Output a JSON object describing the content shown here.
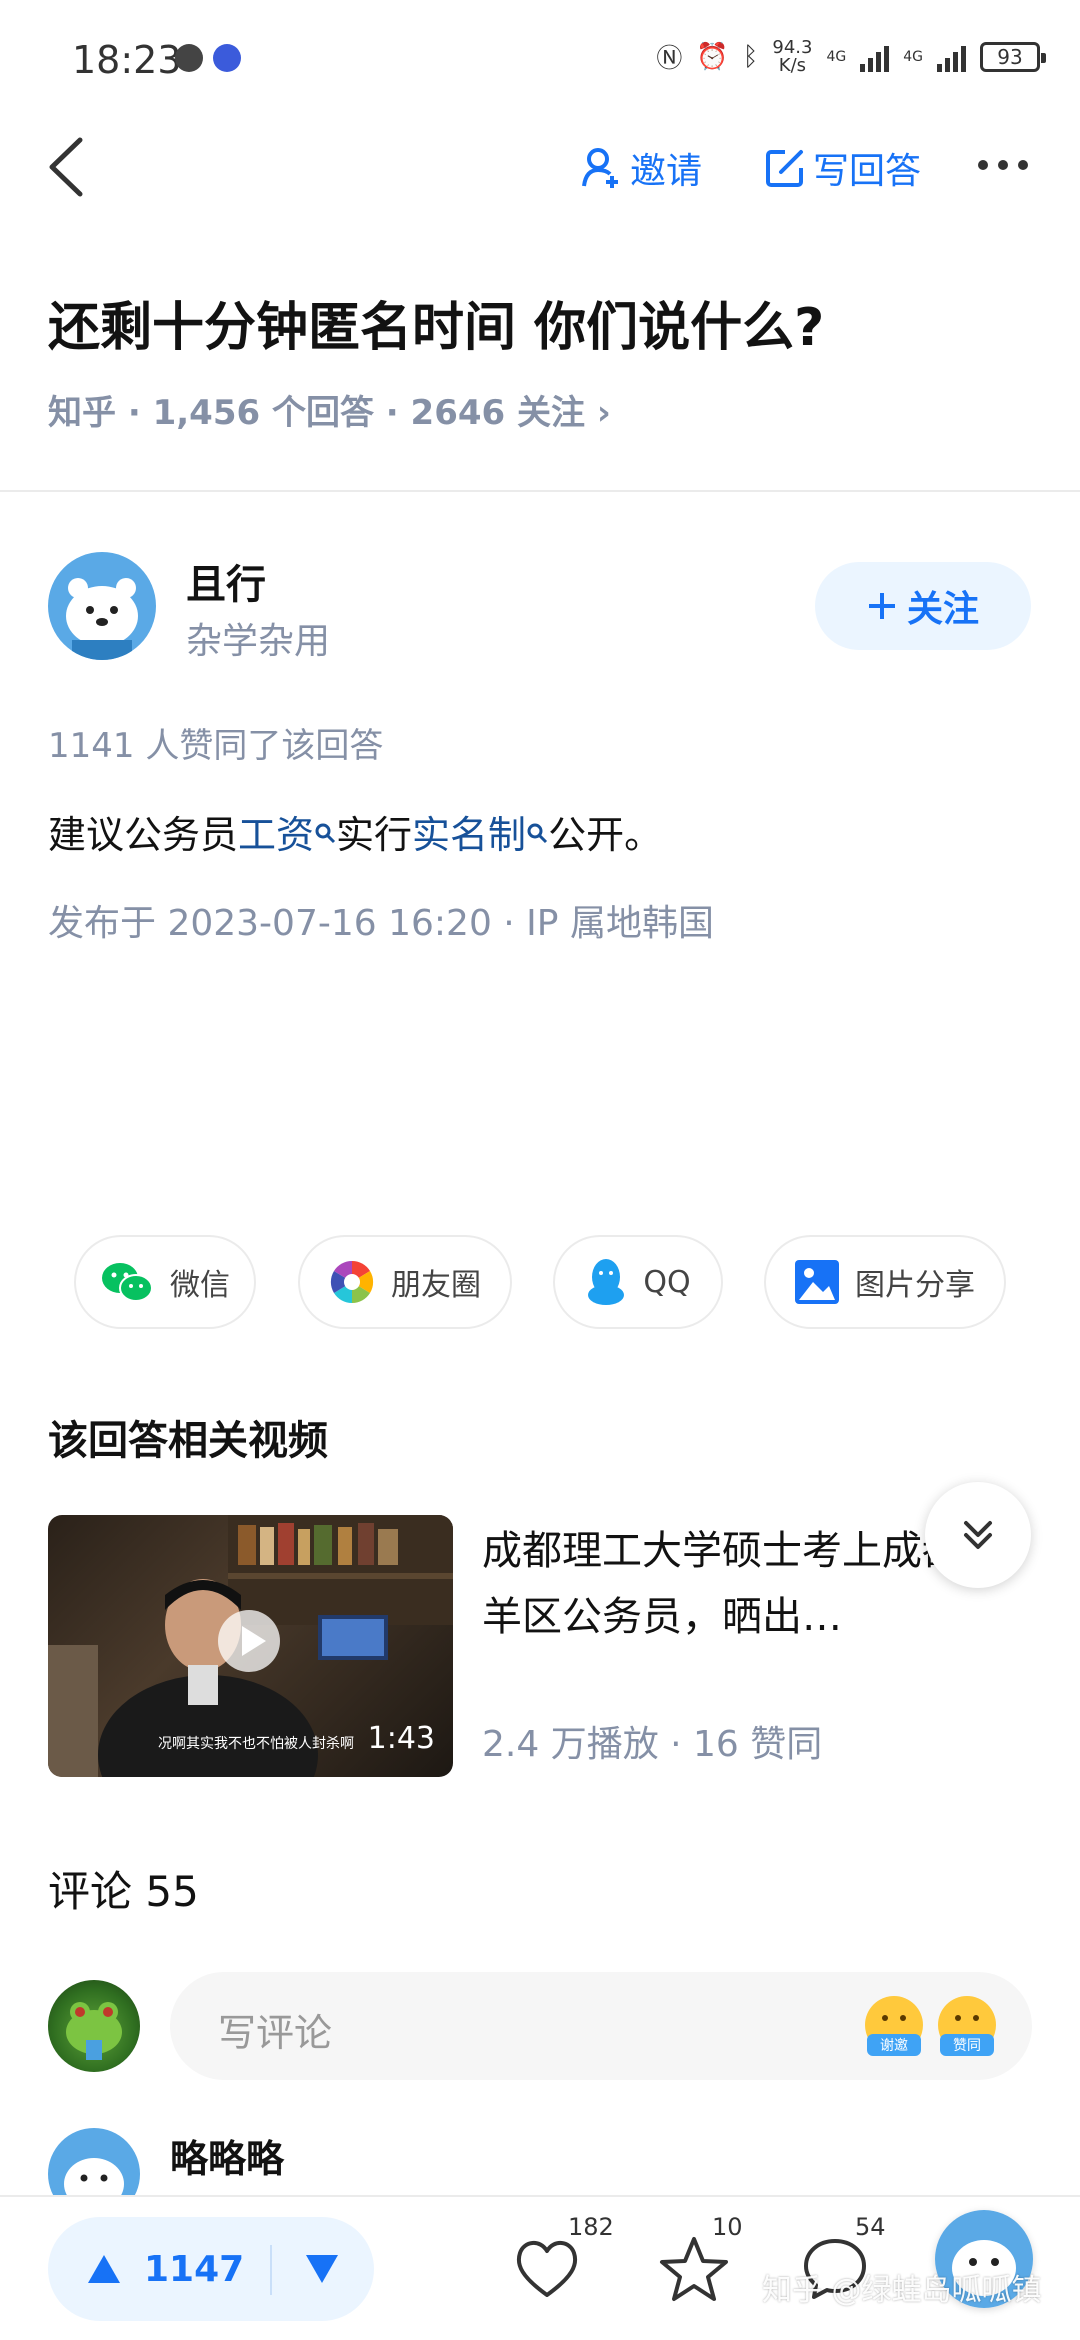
{
  "status_bar": {
    "time": "18:23",
    "net_speed_value": "94.3",
    "net_speed_unit": "K/s",
    "network_1": "4G",
    "network_2": "4G",
    "battery": "93"
  },
  "header": {
    "invite_label": "邀请",
    "write_answer_label": "写回答"
  },
  "question": {
    "title": "还剩十分钟匿名时间 你们说什么?",
    "meta": "知乎 · 1,456 个回答 · 2646 关注 ›"
  },
  "author": {
    "name": "且行",
    "bio": "杂学杂用",
    "follow_label": "关注"
  },
  "answer": {
    "likes_line": "1141 人赞同了该回答",
    "content_prefix": "建议公务员",
    "keyword_1": "工资",
    "content_middle": "实行",
    "keyword_2": "实名制",
    "content_suffix": "公开。",
    "publish_info": "发布于 2023-07-16 16:20 · IP 属地韩国"
  },
  "share": {
    "items": [
      {
        "label": "微信",
        "icon": "wechat-icon"
      },
      {
        "label": "朋友圈",
        "icon": "moments-icon"
      },
      {
        "label": "QQ",
        "icon": "qq-icon"
      },
      {
        "label": "图片分享",
        "icon": "image-share-icon"
      }
    ]
  },
  "related_video": {
    "heading": "该回答相关视频",
    "title": "成都理工大学硕士考上成都青羊区公务员，晒出…",
    "duration": "1:43",
    "subtitle": "况啊其实我不也不怕被人封杀啊",
    "stats": "2.4 万播放 · 16 赞同"
  },
  "comments": {
    "heading": "评论 55",
    "placeholder": "写评论",
    "emoji_1_tag": "谢邀",
    "emoji_2_tag": "赞同",
    "first_commenter": "略略略"
  },
  "bottom_bar": {
    "upvote_count": "1147",
    "like_count": "182",
    "favorite_count": "10",
    "comment_count": "54",
    "watermark": "知乎 @绿蛙岛呱呱镇"
  },
  "colors": {
    "accent": "#1772f6",
    "muted": "#8590a6",
    "link": "#175199",
    "follow_bg": "#ebf5ff"
  }
}
